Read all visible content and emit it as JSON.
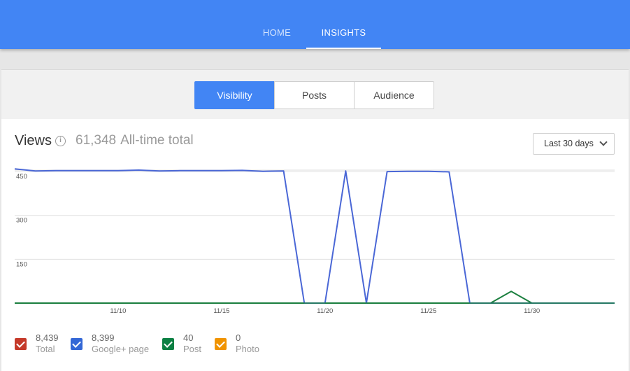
{
  "nav": {
    "tabs": [
      {
        "label": "HOME"
      },
      {
        "label": "INSIGHTS"
      }
    ]
  },
  "segments": [
    {
      "label": "Visibility"
    },
    {
      "label": "Posts"
    },
    {
      "label": "Audience"
    }
  ],
  "views": {
    "title": "Views",
    "total_value": "61,348",
    "total_label": "All-time total"
  },
  "range_dropdown": {
    "selected": "Last 30 days"
  },
  "legend": [
    {
      "value": "8,439",
      "name": "Total",
      "color": "#c53929",
      "checked": true
    },
    {
      "value": "8,399",
      "name": "Google+ page",
      "color": "#3367d6",
      "checked": true
    },
    {
      "value": "40",
      "name": "Post",
      "color": "#0b8043",
      "checked": true
    },
    {
      "value": "0",
      "name": "Photo",
      "color": "#f09300",
      "checked": true
    }
  ],
  "chart_data": {
    "type": "line",
    "x": [
      "11/5",
      "11/6",
      "11/7",
      "11/8",
      "11/9",
      "11/10",
      "11/11",
      "11/12",
      "11/13",
      "11/14",
      "11/15",
      "11/16",
      "11/17",
      "11/18",
      "11/19",
      "11/20",
      "11/21",
      "11/22",
      "11/23",
      "11/24",
      "11/25",
      "11/26",
      "11/27",
      "11/28",
      "11/29",
      "11/30",
      "12/1",
      "12/2",
      "12/3",
      "12/4"
    ],
    "x_tick_labels": [
      "11/10",
      "11/15",
      "11/20",
      "11/25",
      "11/30"
    ],
    "y_tick_labels": [
      "150",
      "300",
      "450"
    ],
    "ylim": [
      0,
      455
    ],
    "grid": true,
    "series": [
      {
        "name": "Google+ page",
        "color": "#4a67d6",
        "values": [
          459,
          452,
          453,
          453,
          453,
          453,
          455,
          452,
          453,
          453,
          453,
          454,
          451,
          452,
          0,
          0,
          452,
          0,
          450,
          451,
          451,
          449,
          0,
          0,
          0,
          0,
          0,
          0,
          0,
          0
        ]
      },
      {
        "name": "Post",
        "color": "#1b7f3f",
        "values": [
          0,
          0,
          0,
          0,
          0,
          0,
          0,
          0,
          0,
          0,
          0,
          0,
          0,
          0,
          0,
          0,
          0,
          0,
          0,
          0,
          0,
          0,
          0,
          0,
          40,
          0,
          0,
          0,
          0,
          0
        ]
      }
    ]
  }
}
